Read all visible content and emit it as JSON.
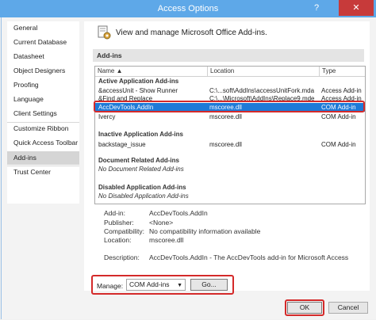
{
  "window": {
    "title": "Access Options",
    "help": "?",
    "close": "✕"
  },
  "sidebar": {
    "items": [
      {
        "label": "General"
      },
      {
        "label": "Current Database"
      },
      {
        "label": "Datasheet"
      },
      {
        "label": "Object Designers"
      },
      {
        "label": "Proofing"
      },
      {
        "label": "Language"
      },
      {
        "label": "Client Settings"
      },
      {
        "label": "Customize Ribbon"
      },
      {
        "label": "Quick Access Toolbar"
      },
      {
        "label": "Add-ins"
      },
      {
        "label": "Trust Center"
      }
    ],
    "selected": "Add-ins"
  },
  "header": {
    "text": "View and manage Microsoft Office Add-ins."
  },
  "section": {
    "title": "Add-ins"
  },
  "grid": {
    "columns": {
      "name": "Name ▲",
      "location": "Location",
      "type": "Type"
    },
    "groups": {
      "active": "Active Application Add-ins",
      "inactive": "Inactive Application Add-ins",
      "document": "Document Related Add-ins",
      "disabled": "Disabled Application Add-ins"
    },
    "active_rows": [
      {
        "name": "&accessUnit - Show Runner",
        "location": "C:\\...soft\\AddIns\\accessUnitFork.mda",
        "type": "Access Add-in"
      },
      {
        "name": "&Find and Replace",
        "location": "C:\\...\\Microsoft\\AddIns\\Replace9.mde",
        "type": "Access Add-in"
      },
      {
        "name": "AccDevTools.AddIn",
        "location": "mscoree.dll",
        "type": "COM Add-in"
      },
      {
        "name": "Ivercy",
        "location": "mscoree.dll",
        "type": "COM Add-in"
      }
    ],
    "inactive_rows": [
      {
        "name": "backstage_issue",
        "location": "mscoree.dll",
        "type": "COM Add-in"
      }
    ],
    "document_note": "No Document Related Add-ins",
    "disabled_note": "No Disabled Application Add-ins"
  },
  "details": {
    "addin_label": "Add-in:",
    "addin": "AccDevTools.AddIn",
    "publisher_label": "Publisher:",
    "publisher": "<None>",
    "compat_label": "Compatibility:",
    "compat": "No compatibility information available",
    "location_label": "Location:",
    "location": "mscoree.dll",
    "desc_label": "Description:",
    "desc": "AccDevTools.AddIn - The AccDevTools add-in for Microsoft Access"
  },
  "manage": {
    "label": "Manage:",
    "selected": "COM Add-ins",
    "go": "Go..."
  },
  "buttons": {
    "ok": "OK",
    "cancel": "Cancel"
  },
  "colors": {
    "titlebar": "#5ea8e8",
    "selection": "#1e7ad7",
    "highlight_box": "#d42a2a"
  }
}
